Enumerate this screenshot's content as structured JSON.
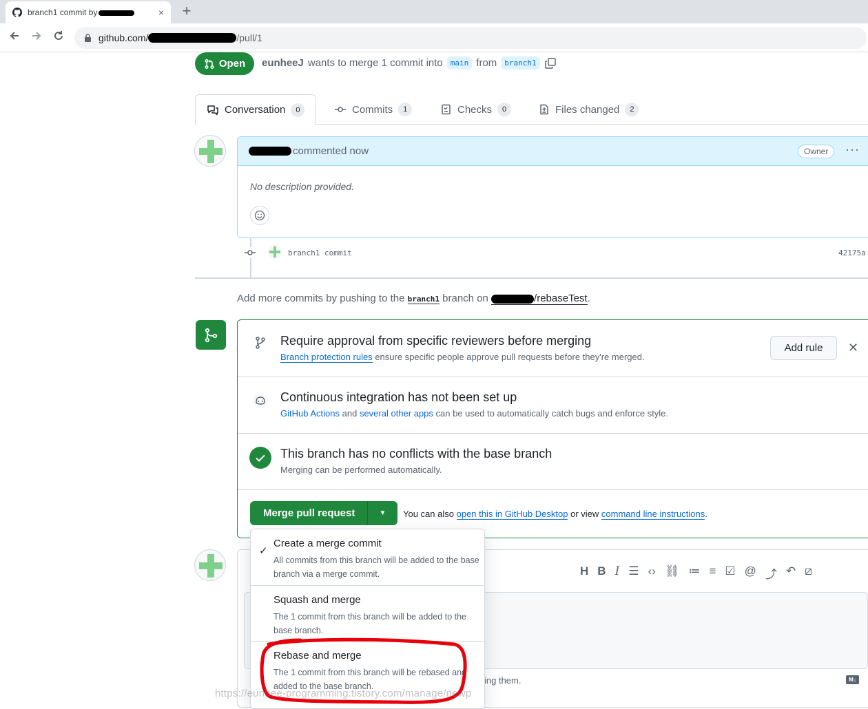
{
  "browser": {
    "tab_title": "branch1 commit by",
    "tab_close": "×",
    "new_tab": "+",
    "url_host": "github.com/",
    "url_path": "/pull/1"
  },
  "pr": {
    "state_label": "Open",
    "author": "eunheeJ",
    "merge_text": "wants to merge 1 commit into",
    "base_branch": "main",
    "from_text": "from",
    "head_branch": "branch1"
  },
  "tabs": [
    {
      "label": "Conversation",
      "count": "0"
    },
    {
      "label": "Commits",
      "count": "1"
    },
    {
      "label": "Checks",
      "count": "0"
    },
    {
      "label": "Files changed",
      "count": "2"
    }
  ],
  "comment": {
    "action": "commented now",
    "role_badge": "Owner",
    "body": "No description provided.",
    "more": "···"
  },
  "commit": {
    "message": "branch1 commit",
    "sha": "42175a"
  },
  "push_hint": {
    "prefix": "Add more commits by pushing to the",
    "branch": "branch1",
    "middle": "branch on",
    "repo": "/rebaseTest",
    "suffix": "."
  },
  "merge_box": {
    "review": {
      "title": "Require approval from specific reviewers before merging",
      "link": "Branch protection rules",
      "desc": "ensure specific people approve pull requests before they're merged.",
      "add_rule": "Add rule",
      "dismiss": "✕"
    },
    "ci": {
      "title": "Continuous integration has not been set up",
      "link1": "GitHub Actions",
      "and": "and",
      "link2": "several other apps",
      "desc": "can be used to automatically catch bugs and enforce style."
    },
    "conflicts": {
      "title": "This branch has no conflicts with the base branch",
      "desc": "Merging can be performed automatically."
    },
    "merge_button": "Merge pull request",
    "also": {
      "prefix": "You can also",
      "link1": "open this in GitHub Desktop",
      "middle": "or view",
      "link2": "command line instructions",
      "suffix": "."
    }
  },
  "merge_menu": [
    {
      "title": "Create a merge commit",
      "desc": "All commits from this branch will be added to the base branch via a merge commit.",
      "selected": true
    },
    {
      "title": "Squash and merge",
      "desc": "The 1 commit from this branch will be added to the base branch.",
      "selected": false
    },
    {
      "title": "Rebase and merge",
      "desc": "The 1 commit from this branch will be rebased and added to the base branch.",
      "selected": false
    }
  ],
  "editor": {
    "footer_fragment": "ing them.",
    "markdown_badge": "M↓"
  },
  "watermark": "https://eunhee-programming.tistory.com/manage/newp",
  "colors": {
    "accent_green": "#1f883d",
    "link_blue": "#0969da",
    "annotation_red": "#e8000b"
  }
}
